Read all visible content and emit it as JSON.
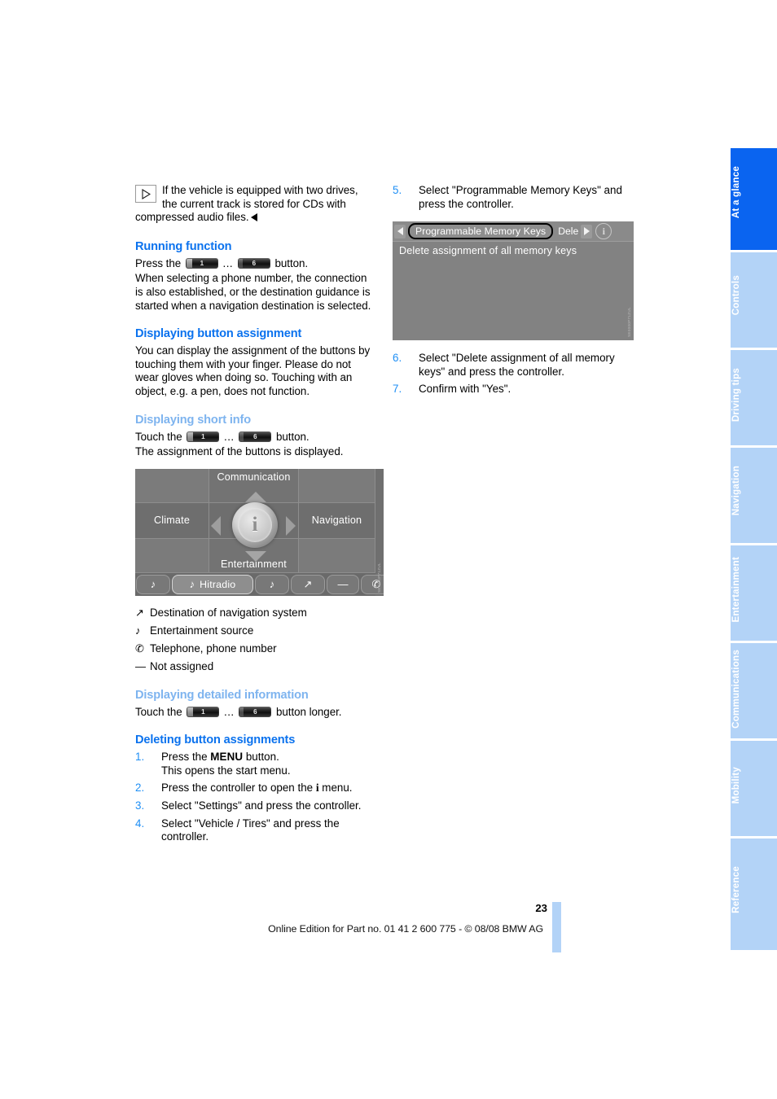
{
  "footer": {
    "page_number": "23",
    "edition_line": "Online Edition for Part no. 01 41 2 600 775 - © 08/08 BMW AG"
  },
  "rail": {
    "tabs": [
      {
        "label": "At a glance",
        "active": true
      },
      {
        "label": "Controls",
        "active": false
      },
      {
        "label": "Driving tips",
        "active": false
      },
      {
        "label": "Navigation",
        "active": false
      },
      {
        "label": "Entertainment",
        "active": false
      },
      {
        "label": "Communications",
        "active": false
      },
      {
        "label": "Mobility",
        "active": false
      },
      {
        "label": "Reference",
        "active": false
      }
    ],
    "colors": {
      "active_bg": "#0a64f0",
      "inactive_bg": "#b3d3f7",
      "text": "#ffffff"
    }
  },
  "colors": {
    "heading_major": "#0b72ee",
    "heading_minor": "#7eb4ef",
    "step_number": "#1f8ff5",
    "screenshot_gray": "#7a7a7a"
  },
  "left_column": {
    "note": {
      "icon": "play-triangle-icon",
      "text": "If the vehicle is equipped with two drives, the current track is stored for CDs with compressed audio files."
    },
    "running_function": {
      "heading": "Running function",
      "press_prefix": "Press the",
      "key_low": "1",
      "key_ellipsis": "...",
      "key_high": "6",
      "press_suffix": "button.",
      "body": "When selecting a phone number, the connection is also established, or the destination guidance is started when a navigation destination is selected."
    },
    "displaying_button_assignment": {
      "heading": "Displaying button assignment",
      "body": "You can display the assignment of the buttons by touching them with your finger. Please do not wear gloves when doing so. Touching with an object, e.g. a pen, does not function."
    },
    "displaying_short_info": {
      "heading": "Displaying short info",
      "touch_prefix": "Touch the",
      "key_low": "1",
      "key_ellipsis": "...",
      "key_high": "6",
      "touch_suffix": "button.",
      "body": "The assignment of the buttons is displayed."
    },
    "start_menu_screenshot": {
      "cells": {
        "top_left": "",
        "communication": "Communication",
        "top_right": "",
        "climate": "Climate",
        "center": "i",
        "navigation": "Navigation",
        "bottom_left": "",
        "entertainment": "Entertainment",
        "bottom_right": ""
      },
      "bottom_bar": [
        {
          "glyph": "♪",
          "label": "",
          "selected": false,
          "icon": "music-note-icon"
        },
        {
          "glyph": "♪",
          "label": "Hitradio",
          "selected": true,
          "icon": "music-note-icon"
        },
        {
          "glyph": "♪",
          "label": "",
          "selected": false,
          "icon": "music-note-icon"
        },
        {
          "glyph": "↗",
          "label": "",
          "selected": false,
          "icon": "navigation-destination-icon"
        },
        {
          "glyph": "—",
          "label": "",
          "selected": false,
          "icon": "not-assigned-icon"
        },
        {
          "glyph": "✆",
          "label": "",
          "selected": false,
          "icon": "telephone-icon"
        }
      ],
      "watermark": "SE0000P71ZUL"
    },
    "legend": [
      {
        "glyph": "↗",
        "icon": "navigation-destination-icon",
        "text": "Destination of navigation system"
      },
      {
        "glyph": "♪",
        "icon": "music-note-icon",
        "text": "Entertainment source"
      },
      {
        "glyph": "✆",
        "icon": "telephone-icon",
        "text": "Telephone, phone number"
      },
      {
        "glyph": "—",
        "icon": "not-assigned-icon",
        "text": "Not assigned"
      }
    ],
    "displaying_detailed_information": {
      "heading": "Displaying detailed information",
      "touch_prefix": "Touch the",
      "key_low": "1",
      "key_ellipsis": "...",
      "key_high": "6",
      "touch_suffix": "button longer."
    },
    "deleting_button_assignments": {
      "heading": "Deleting button assignments",
      "steps": [
        {
          "num": "1.",
          "text_before": "Press the ",
          "bold": "MENU",
          "text_after": " button.",
          "line2": "This opens the start menu."
        },
        {
          "num": "2.",
          "text_before": "Press the controller to open the ",
          "bold_serif": "i",
          "text_after": " menu.",
          "line2": ""
        },
        {
          "num": "3.",
          "text_before": "Select \"Settings\" and press the controller.",
          "bold": "",
          "text_after": "",
          "line2": ""
        },
        {
          "num": "4.",
          "text_before": "Select \"Vehicle / Tires\" and press the controller.",
          "bold": "",
          "text_after": "",
          "line2": ""
        }
      ]
    }
  },
  "right_column": {
    "steps_top": [
      {
        "num": "5.",
        "text": "Select \"Programmable Memory Keys\" and press the controller."
      }
    ],
    "memory_keys_screenshot": {
      "left_arrow": "◀",
      "selected_tab": "Programmable Memory Keys",
      "next_tab_truncated": "Dele",
      "right_arrow": "▶",
      "info_icon": "info-circle-icon",
      "list_item": "Delete assignment of all memory keys",
      "watermark": "SE0000P71ZUL"
    },
    "steps_bottom": [
      {
        "num": "6.",
        "text": "Select \"Delete assignment of all memory keys\" and press the controller."
      },
      {
        "num": "7.",
        "text": "Confirm with \"Yes\"."
      }
    ]
  }
}
